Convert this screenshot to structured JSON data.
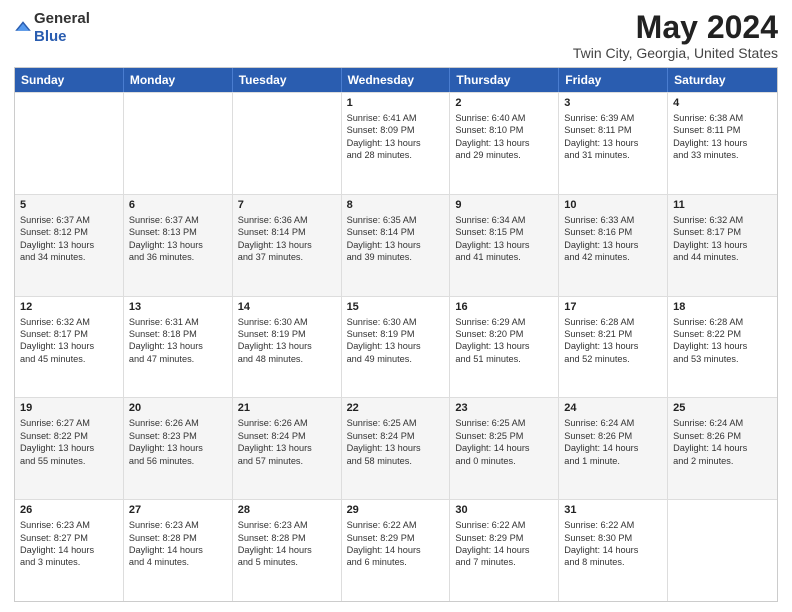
{
  "header": {
    "logo_general": "General",
    "logo_blue": "Blue",
    "title": "May 2024",
    "subtitle": "Twin City, Georgia, United States"
  },
  "calendar": {
    "days_of_week": [
      "Sunday",
      "Monday",
      "Tuesday",
      "Wednesday",
      "Thursday",
      "Friday",
      "Saturday"
    ],
    "weeks": [
      [
        {
          "day": "",
          "info": ""
        },
        {
          "day": "",
          "info": ""
        },
        {
          "day": "",
          "info": ""
        },
        {
          "day": "1",
          "info": "Sunrise: 6:41 AM\nSunset: 8:09 PM\nDaylight: 13 hours\nand 28 minutes."
        },
        {
          "day": "2",
          "info": "Sunrise: 6:40 AM\nSunset: 8:10 PM\nDaylight: 13 hours\nand 29 minutes."
        },
        {
          "day": "3",
          "info": "Sunrise: 6:39 AM\nSunset: 8:11 PM\nDaylight: 13 hours\nand 31 minutes."
        },
        {
          "day": "4",
          "info": "Sunrise: 6:38 AM\nSunset: 8:11 PM\nDaylight: 13 hours\nand 33 minutes."
        }
      ],
      [
        {
          "day": "5",
          "info": "Sunrise: 6:37 AM\nSunset: 8:12 PM\nDaylight: 13 hours\nand 34 minutes."
        },
        {
          "day": "6",
          "info": "Sunrise: 6:37 AM\nSunset: 8:13 PM\nDaylight: 13 hours\nand 36 minutes."
        },
        {
          "day": "7",
          "info": "Sunrise: 6:36 AM\nSunset: 8:14 PM\nDaylight: 13 hours\nand 37 minutes."
        },
        {
          "day": "8",
          "info": "Sunrise: 6:35 AM\nSunset: 8:14 PM\nDaylight: 13 hours\nand 39 minutes."
        },
        {
          "day": "9",
          "info": "Sunrise: 6:34 AM\nSunset: 8:15 PM\nDaylight: 13 hours\nand 41 minutes."
        },
        {
          "day": "10",
          "info": "Sunrise: 6:33 AM\nSunset: 8:16 PM\nDaylight: 13 hours\nand 42 minutes."
        },
        {
          "day": "11",
          "info": "Sunrise: 6:32 AM\nSunset: 8:17 PM\nDaylight: 13 hours\nand 44 minutes."
        }
      ],
      [
        {
          "day": "12",
          "info": "Sunrise: 6:32 AM\nSunset: 8:17 PM\nDaylight: 13 hours\nand 45 minutes."
        },
        {
          "day": "13",
          "info": "Sunrise: 6:31 AM\nSunset: 8:18 PM\nDaylight: 13 hours\nand 47 minutes."
        },
        {
          "day": "14",
          "info": "Sunrise: 6:30 AM\nSunset: 8:19 PM\nDaylight: 13 hours\nand 48 minutes."
        },
        {
          "day": "15",
          "info": "Sunrise: 6:30 AM\nSunset: 8:19 PM\nDaylight: 13 hours\nand 49 minutes."
        },
        {
          "day": "16",
          "info": "Sunrise: 6:29 AM\nSunset: 8:20 PM\nDaylight: 13 hours\nand 51 minutes."
        },
        {
          "day": "17",
          "info": "Sunrise: 6:28 AM\nSunset: 8:21 PM\nDaylight: 13 hours\nand 52 minutes."
        },
        {
          "day": "18",
          "info": "Sunrise: 6:28 AM\nSunset: 8:22 PM\nDaylight: 13 hours\nand 53 minutes."
        }
      ],
      [
        {
          "day": "19",
          "info": "Sunrise: 6:27 AM\nSunset: 8:22 PM\nDaylight: 13 hours\nand 55 minutes."
        },
        {
          "day": "20",
          "info": "Sunrise: 6:26 AM\nSunset: 8:23 PM\nDaylight: 13 hours\nand 56 minutes."
        },
        {
          "day": "21",
          "info": "Sunrise: 6:26 AM\nSunset: 8:24 PM\nDaylight: 13 hours\nand 57 minutes."
        },
        {
          "day": "22",
          "info": "Sunrise: 6:25 AM\nSunset: 8:24 PM\nDaylight: 13 hours\nand 58 minutes."
        },
        {
          "day": "23",
          "info": "Sunrise: 6:25 AM\nSunset: 8:25 PM\nDaylight: 14 hours\nand 0 minutes."
        },
        {
          "day": "24",
          "info": "Sunrise: 6:24 AM\nSunset: 8:26 PM\nDaylight: 14 hours\nand 1 minute."
        },
        {
          "day": "25",
          "info": "Sunrise: 6:24 AM\nSunset: 8:26 PM\nDaylight: 14 hours\nand 2 minutes."
        }
      ],
      [
        {
          "day": "26",
          "info": "Sunrise: 6:23 AM\nSunset: 8:27 PM\nDaylight: 14 hours\nand 3 minutes."
        },
        {
          "day": "27",
          "info": "Sunrise: 6:23 AM\nSunset: 8:28 PM\nDaylight: 14 hours\nand 4 minutes."
        },
        {
          "day": "28",
          "info": "Sunrise: 6:23 AM\nSunset: 8:28 PM\nDaylight: 14 hours\nand 5 minutes."
        },
        {
          "day": "29",
          "info": "Sunrise: 6:22 AM\nSunset: 8:29 PM\nDaylight: 14 hours\nand 6 minutes."
        },
        {
          "day": "30",
          "info": "Sunrise: 6:22 AM\nSunset: 8:29 PM\nDaylight: 14 hours\nand 7 minutes."
        },
        {
          "day": "31",
          "info": "Sunrise: 6:22 AM\nSunset: 8:30 PM\nDaylight: 14 hours\nand 8 minutes."
        },
        {
          "day": "",
          "info": ""
        }
      ]
    ]
  }
}
